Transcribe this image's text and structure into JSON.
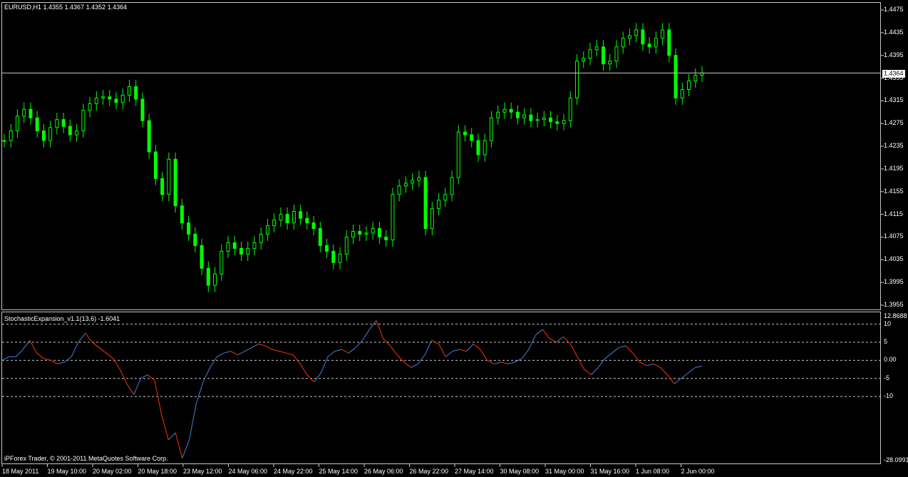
{
  "main_chart": {
    "header": "EURUSD,H1  1.4355 1.4367 1.4352 1.4364",
    "current_price": "1.4364",
    "y_labels": [
      "1.4475",
      "1.4435",
      "1.4395",
      "1.4355",
      "1.4315",
      "1.4275",
      "1.4235",
      "1.4195",
      "1.4155",
      "1.4115",
      "1.4075",
      "1.4035",
      "1.3995",
      "1.3955"
    ],
    "candle_color": "#00ff00"
  },
  "indicator": {
    "header": "StochasticExpansion_v1.1(13,6) -1.6041",
    "y_labels": [
      "12.8688",
      "10",
      "5",
      "0.00",
      "-5",
      "-10",
      "-28.0991"
    ],
    "copyright": "iPForex Trader, © 2001-2011 MetaQuotes Software Corp.",
    "up_color": "#4a7fd4",
    "down_color": "#ff3300"
  },
  "x_labels": [
    "18 May 2011",
    "19 May 10:00",
    "20 May 02:00",
    "20 May 18:00",
    "23 May 12:00",
    "24 May 06:00",
    "24 May 22:00",
    "25 May 14:00",
    "26 May 06:00",
    "26 May 22:00",
    "27 May 14:00",
    "30 May 08:00",
    "31 May 00:00",
    "31 May 16:00",
    "1 Jun 08:00",
    "2 Jun 00:00"
  ],
  "chart_data": [
    {
      "type": "line",
      "title": "EURUSD,H1",
      "ylabel": "",
      "xlabel": "",
      "ylim": [
        1.3955,
        1.4475
      ],
      "series": [
        {
          "name": "EURUSD,H1",
          "values": [
            1.4245,
            1.4262,
            1.4288,
            1.43,
            1.4285,
            1.4262,
            1.4245,
            1.4268,
            1.4282,
            1.427,
            1.4255,
            1.4262,
            1.4298,
            1.431,
            1.432,
            1.4322,
            1.4318,
            1.4312,
            1.4325,
            1.434,
            1.4318,
            1.428,
            1.4225,
            1.4178,
            1.415,
            1.4212,
            1.413,
            1.41,
            1.408,
            1.406,
            1.402,
            1.399,
            1.401,
            1.405,
            1.4065,
            1.4055,
            1.4045,
            1.4055,
            1.4065,
            1.408,
            1.4095,
            1.4105,
            1.4115,
            1.41,
            1.412,
            1.4108,
            1.41,
            1.409,
            1.406,
            1.405,
            1.403,
            1.4045,
            1.4075,
            1.4085,
            1.408,
            1.4082,
            1.409,
            1.4075,
            1.407,
            1.415,
            1.4165,
            1.417,
            1.4175,
            1.418,
            1.409,
            1.4125,
            1.414,
            1.415,
            1.418,
            1.426,
            1.4255,
            1.4245,
            1.422,
            1.4245,
            1.4285,
            1.4295,
            1.43,
            1.4295,
            1.4285,
            1.429,
            1.428,
            1.4282,
            1.4285,
            1.4278,
            1.4275,
            1.428,
            1.432,
            1.4385,
            1.439,
            1.4405,
            1.441,
            1.438,
            1.4385,
            1.441,
            1.4425,
            1.443,
            1.444,
            1.4415,
            1.441,
            1.4425,
            1.444,
            1.4395,
            1.432,
            1.4335,
            1.435,
            1.436,
            1.4364
          ]
        }
      ]
    },
    {
      "type": "line",
      "title": "StochasticExpansion_v1.1(13,6) -1.6041",
      "ylabel": "",
      "xlabel": "",
      "ylim": [
        -28.0991,
        12.8688
      ],
      "series": [
        {
          "name": "StochasticExpansion_v1.1(13,6)",
          "values": [
            0.0,
            1.0,
            1.0,
            3.0,
            5.5,
            2.0,
            0.5,
            0.0,
            -1.0,
            -0.5,
            1.0,
            5.0,
            7.5,
            5.0,
            3.5,
            2.0,
            0.5,
            -2.5,
            -6.5,
            -9.5,
            -5.0,
            -4.0,
            -5.5,
            -15.0,
            -22.0,
            -20.0,
            -27.0,
            -22.0,
            -12.0,
            -6.0,
            -2.0,
            1.0,
            2.0,
            2.5,
            1.5,
            2.5,
            3.5,
            4.5,
            4.0,
            3.0,
            2.5,
            2.0,
            1.5,
            -1.0,
            -4.0,
            -6.0,
            -3.5,
            1.0,
            2.5,
            3.0,
            2.0,
            3.5,
            5.5,
            8.5,
            11.0,
            6.0,
            4.0,
            1.5,
            -0.5,
            -2.0,
            -1.0,
            1.5,
            5.5,
            4.5,
            1.0,
            2.5,
            3.0,
            2.5,
            4.5,
            3.0,
            0.0,
            -1.0,
            -0.5,
            -1.0,
            -0.5,
            0.5,
            3.0,
            7.0,
            8.5,
            6.0,
            5.0,
            6.5,
            4.5,
            1.0,
            -2.5,
            -4.0,
            -2.0,
            0.5,
            2.0,
            3.5,
            4.0,
            2.0,
            -0.5,
            -1.5,
            -1.0,
            -2.0,
            -4.0,
            -6.5,
            -5.0,
            -3.5,
            -2.0,
            -1.6041
          ]
        }
      ]
    }
  ]
}
